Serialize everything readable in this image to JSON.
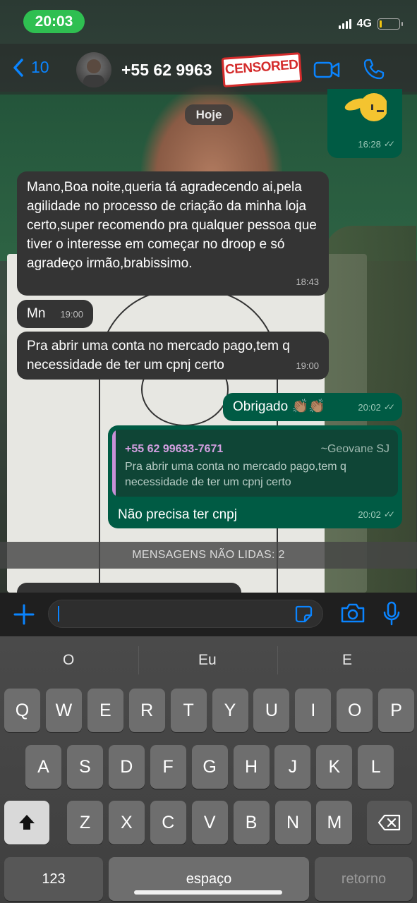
{
  "status_bar": {
    "time": "20:03",
    "network": "4G"
  },
  "header": {
    "back_count": "10",
    "contact": "+55 62 9963",
    "censor_label": "CENSORED"
  },
  "date_pill": "Hoje",
  "messages": [
    {
      "time": "16:28"
    },
    {
      "text": "Mano,Boa noite,queria tá agradecendo ai,pela agilidade no processo de criação da minha loja certo,super recomendo pra qualquer pessoa que tiver o interesse em começar no droop e só agradeço irmão,brabissimo.",
      "time": "18:43"
    },
    {
      "text": "Mn",
      "time": "19:00"
    },
    {
      "text": "Pra abrir uma conta no mercado pago,tem q necessidade de ter um cpnj certo",
      "time": "19:00"
    },
    {
      "text": "Obrigado 👏🏽👏🏽",
      "time": "20:02"
    },
    {
      "quote_name": "+55 62 99633-7671",
      "quote_alias": "~Geovane SJ",
      "quote_text": "Pra abrir uma conta no mercado pago,tem q necessidade de ter um cpnj certo",
      "text": "Não  precisa ter cnpj",
      "time": "20:02"
    }
  ],
  "unread_banner": "MENSAGENS NÃO LIDAS: 2",
  "keyboard": {
    "suggestions": [
      "O",
      "Eu",
      "E"
    ],
    "row1": [
      "Q",
      "W",
      "E",
      "R",
      "T",
      "Y",
      "U",
      "I",
      "O",
      "P"
    ],
    "row2": [
      "A",
      "S",
      "D",
      "F",
      "G",
      "H",
      "J",
      "K",
      "L"
    ],
    "row3": [
      "Z",
      "X",
      "C",
      "V",
      "B",
      "N",
      "M"
    ],
    "numbers": "123",
    "space": "espaço",
    "return": "retorno"
  },
  "colors": {
    "accent": "#0a84ff",
    "outgoing_bubble": "#005b44",
    "incoming_bubble": "#343434",
    "status_pill": "#2fbf51"
  }
}
